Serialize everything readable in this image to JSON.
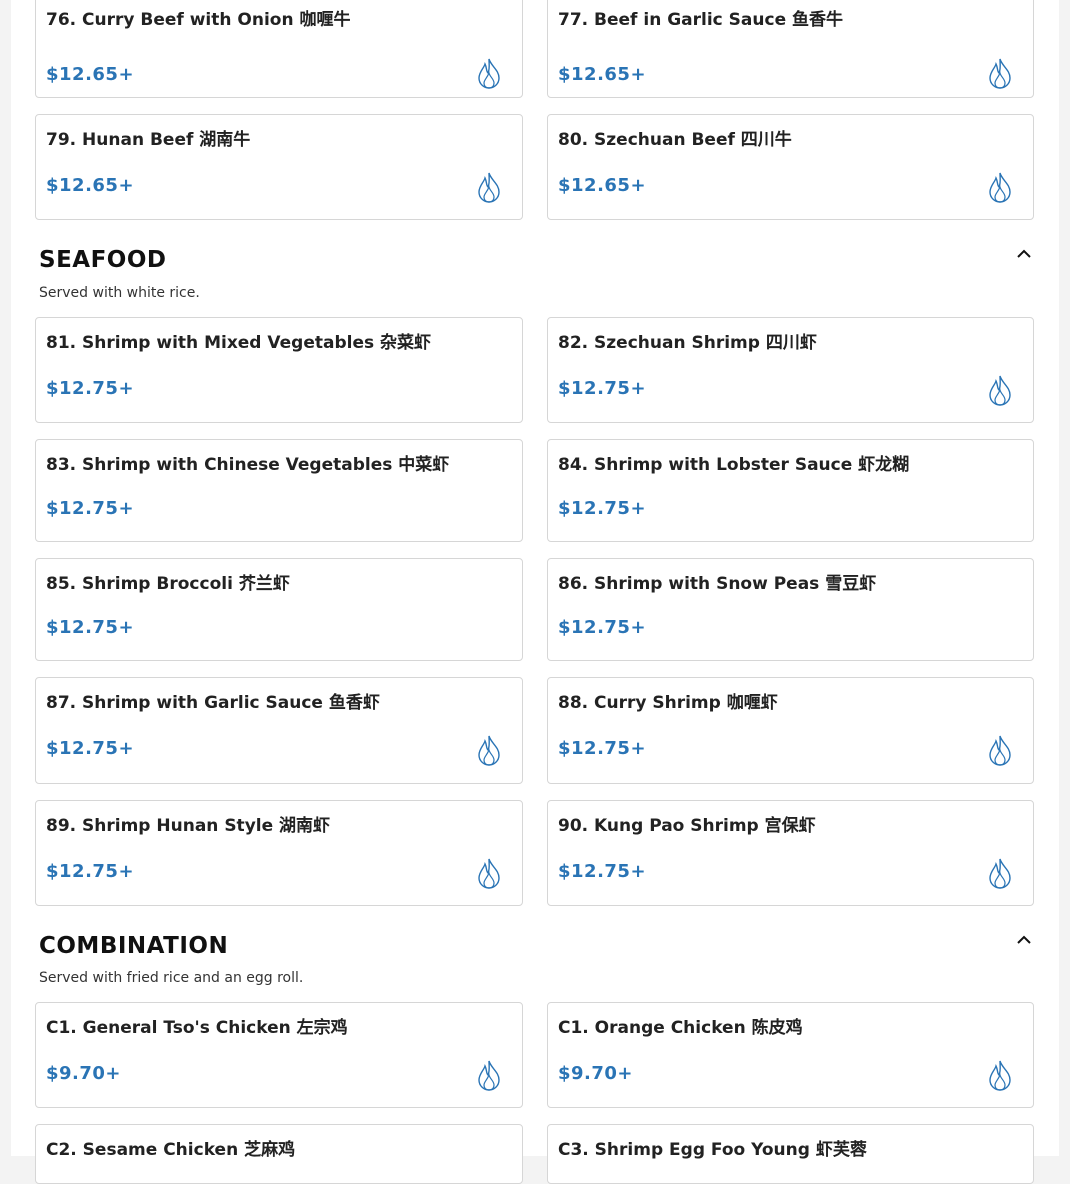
{
  "colors": {
    "price": "#2a74b5",
    "spicy_icon": "#2a74b5"
  },
  "beef_tail": {
    "items": [
      {
        "name": "76. Curry Beef with Onion 咖喱牛",
        "price": "$12.65+",
        "spicy": true
      },
      {
        "name": "77. Beef in Garlic Sauce 鱼香牛",
        "price": "$12.65+",
        "spicy": true
      },
      {
        "name": "79. Hunan Beef 湖南牛",
        "price": "$12.65+",
        "spicy": true
      },
      {
        "name": "80. Szechuan Beef 四川牛",
        "price": "$12.65+",
        "spicy": true
      }
    ]
  },
  "seafood": {
    "title": "SEAFOOD",
    "description": "Served with white rice.",
    "toggle_icon": "chevron-up-icon",
    "items": [
      {
        "name": "81. Shrimp with Mixed Vegetables 杂菜虾",
        "price": "$12.75+",
        "spicy": false
      },
      {
        "name": "82. Szechuan Shrimp 四川虾",
        "price": "$12.75+",
        "spicy": true
      },
      {
        "name": "83. Shrimp with Chinese Vegetables 中菜虾",
        "price": "$12.75+",
        "spicy": false
      },
      {
        "name": "84. Shrimp with Lobster Sauce 虾龙糊",
        "price": "$12.75+",
        "spicy": false
      },
      {
        "name": "85. Shrimp Broccoli 芥兰虾",
        "price": "$12.75+",
        "spicy": false
      },
      {
        "name": "86. Shrimp with Snow Peas 雪豆虾",
        "price": "$12.75+",
        "spicy": false
      },
      {
        "name": "87. Shrimp with Garlic Sauce 鱼香虾",
        "price": "$12.75+",
        "spicy": true
      },
      {
        "name": "88. Curry Shrimp 咖喱虾",
        "price": "$12.75+",
        "spicy": true
      },
      {
        "name": "89. Shrimp Hunan Style 湖南虾",
        "price": "$12.75+",
        "spicy": true
      },
      {
        "name": "90. Kung Pao Shrimp 宫保虾",
        "price": "$12.75+",
        "spicy": true
      }
    ]
  },
  "combination": {
    "title": "COMBINATION",
    "description": "Served with fried rice and an egg roll.",
    "toggle_icon": "chevron-up-icon",
    "items": [
      {
        "name": "C1. General Tso's Chicken 左宗鸡",
        "price": "$9.70+",
        "spicy": true
      },
      {
        "name": "C1. Orange Chicken 陈皮鸡",
        "price": "$9.70+",
        "spicy": true
      },
      {
        "name": "C2. Sesame Chicken 芝麻鸡",
        "price": "",
        "spicy": false
      },
      {
        "name": "C3. Shrimp Egg Foo Young 虾芙蓉",
        "price": "",
        "spicy": false
      }
    ]
  }
}
